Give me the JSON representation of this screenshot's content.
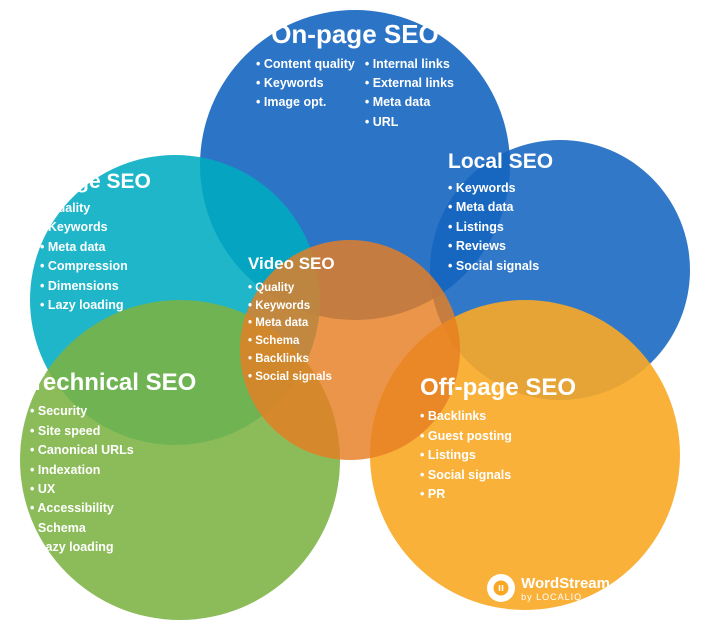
{
  "circles": {
    "onpage": {
      "title": "On-page SEO",
      "items_left": [
        "Content quality",
        "Keywords",
        "Image opt."
      ],
      "items_right": [
        "Internal links",
        "External links",
        "Meta data",
        "URL"
      ]
    },
    "image": {
      "title": "Image SEO",
      "items": [
        "Quality",
        "Keywords",
        "Meta data",
        "Compression",
        "Dimensions",
        "Lazy loading"
      ]
    },
    "local": {
      "title": "Local SEO",
      "items": [
        "Keywords",
        "Meta data",
        "Listings",
        "Reviews",
        "Social signals"
      ]
    },
    "technical": {
      "title": "Technical SEO",
      "items": [
        "Security",
        "Site speed",
        "Canonical URLs",
        "Indexation",
        "UX",
        "Accessibility",
        "Schema",
        "Lazy loading"
      ]
    },
    "offpage": {
      "title": "Off-page SEO",
      "items": [
        "Backlinks",
        "Guest posting",
        "Listings",
        "Social signals",
        "PR"
      ]
    },
    "video": {
      "title": "Video SEO",
      "items": [
        "Quality",
        "Keywords",
        "Meta data",
        "Schema",
        "Backlinks",
        "Social signals"
      ]
    }
  },
  "branding": {
    "main": "WordStream",
    "sub": "by LOCALIQ"
  }
}
